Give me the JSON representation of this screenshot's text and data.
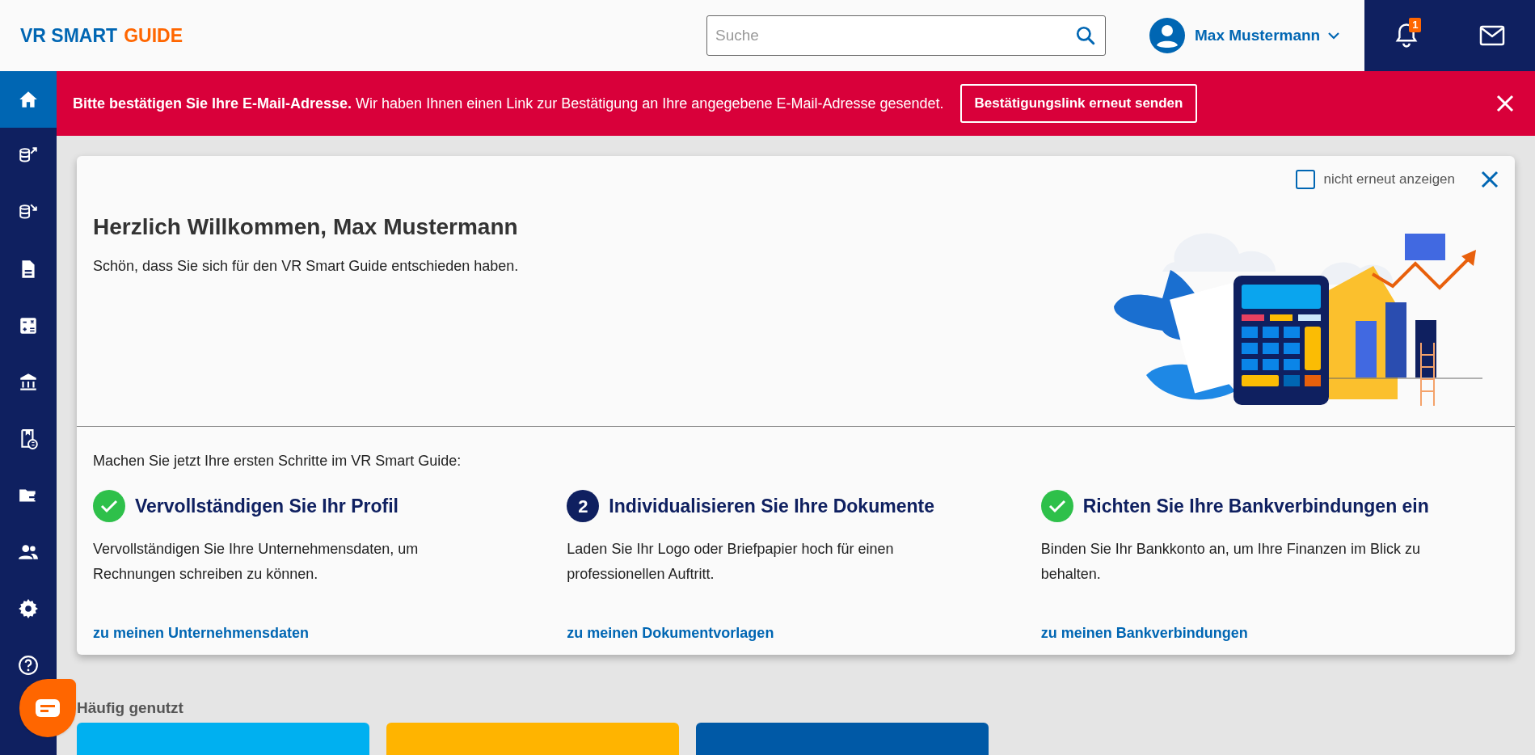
{
  "header": {
    "logo": {
      "first": "VR SMART",
      "second": "GUIDE"
    },
    "search": {
      "placeholder": "Suche"
    },
    "user": {
      "name": "Max Mustermann"
    },
    "notifications": {
      "count": "1"
    }
  },
  "sidebar": {
    "items": [
      {
        "selected": true
      },
      {
        "selected": false
      },
      {
        "selected": false
      },
      {
        "selected": false
      },
      {
        "selected": false
      },
      {
        "selected": false
      },
      {
        "selected": false
      },
      {
        "selected": false
      },
      {
        "selected": false
      },
      {
        "selected": false
      },
      {
        "selected": false
      }
    ]
  },
  "banner": {
    "message": "**Bitte bestätigen Sie Ihre E-Mail-Adresse.** Wir haben Ihnen einen Link zur Bestätigung an Ihre angegebene E-Mail-Adresse gesendet.",
    "button": "Bestätigungslink erneut senden"
  },
  "welcome": {
    "dont_show_again": {
      "label": "nicht erneut anzeigen",
      "checked": false
    },
    "title": "Herzlich Willkommen, Max Mustermann",
    "subtitle": "Schön, dass Sie sich für den VR Smart Guide entschieden haben.",
    "steps_intro": "Machen Sie jetzt Ihre ersten Schritte im VR Smart Guide:",
    "steps": [
      {
        "done": true,
        "title": "Vervollständigen Sie Ihr Profil",
        "text": "Vervollständigen Sie Ihre Unternehmensdaten, um Rechnungen schreiben zu können.",
        "link": "zu meinen Unternehmensdaten"
      },
      {
        "done": false,
        "number": "2",
        "title": "Individualisieren Sie Ihre Dokumente",
        "text": "Laden Sie Ihr Logo oder Briefpapier hoch für einen professionellen Auftritt.",
        "link": "zu meinen Dokumentvorlagen"
      },
      {
        "done": true,
        "title": "Richten Sie Ihre Bankverbindungen ein",
        "text": "Binden Sie Ihr Bankkonto an, um Ihre Finanzen im Blick zu behalten.",
        "link": "zu meinen Bankverbindungen"
      }
    ]
  },
  "frequently_used": {
    "title": "Häufig genutzt",
    "tiles": [
      {
        "color": "#00b0f0"
      },
      {
        "color": "#ffb400"
      },
      {
        "color": "#0059a6"
      }
    ]
  }
}
